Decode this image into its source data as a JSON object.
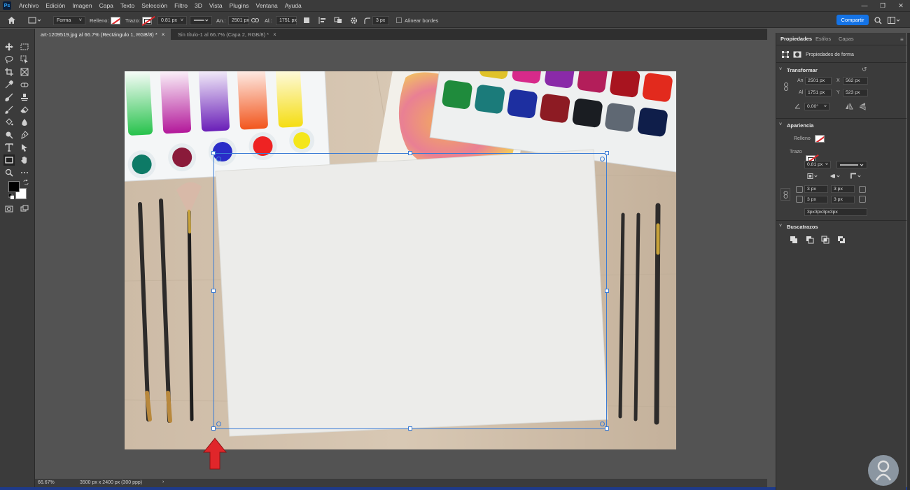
{
  "menu": [
    "Archivo",
    "Edición",
    "Imagen",
    "Capa",
    "Texto",
    "Selección",
    "Filtro",
    "3D",
    "Vista",
    "Plugins",
    "Ventana",
    "Ayuda"
  ],
  "app_logo": "Ps",
  "options": {
    "mode": "Forma",
    "fill_label": "Relleno:",
    "stroke_label": "Trazo:",
    "stroke_width": "0.81 px",
    "width_label": "An.:",
    "width_value": "2501 px",
    "height_label": "Al.:",
    "height_value": "1751 px",
    "radius_value": "3 px",
    "align_edges": "Alinear bordes",
    "share": "Compartir"
  },
  "tabs": [
    {
      "label": "art-1209519.jpg al 66.7% (Rectángulo 1, RGB/8) *",
      "active": true
    },
    {
      "label": "Sin título-1 al 66.7% (Capa 2, RGB/8) *",
      "active": false
    }
  ],
  "status": {
    "zoom": "66.67%",
    "doc_info": "3500 px x 2400 px (300 ppp)",
    "arrow": "›"
  },
  "panel": {
    "tabs": [
      "Propiedades",
      "Estilos",
      "Capas"
    ],
    "shape_props": "Propiedades de forma",
    "transform": {
      "title": "Transformar",
      "w_label": "An",
      "w": "2501 px",
      "x_label": "X",
      "x": "562 px",
      "h_label": "Al",
      "h": "1751 px",
      "y_label": "Y",
      "y": "523 px",
      "angle": "0.00°"
    },
    "appearance": {
      "title": "Apariencia",
      "fill_label": "Relleno",
      "stroke_label": "Trazo",
      "stroke_width": "0.81 px",
      "corners": [
        "3 px",
        "3 px",
        "3 px",
        "3 px"
      ],
      "corner_summary": "3px3px3px3px"
    },
    "pathfinder": {
      "title": "Buscatrazos"
    }
  },
  "colors": {
    "accent": "#1473e6",
    "selection": "#3a7bd5",
    "arrow": "#e0262a"
  }
}
